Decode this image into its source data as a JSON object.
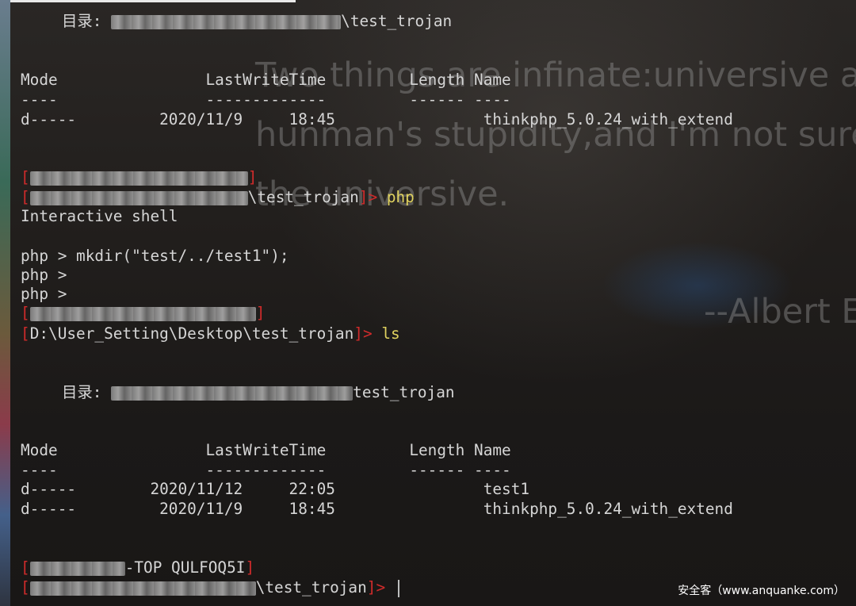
{
  "wallpaper": {
    "quote_line1": "Two things are infinate:universive ar",
    "quote_line2": "hunman's stupidity,and I'm not sure",
    "quote_line3": "the universive.",
    "quote_author": "--Albert E"
  },
  "terminal": {
    "dir1_label": "目录: ",
    "dir1_suffix": "\\test_trojan",
    "table1": {
      "header": "Mode                LastWriteTime         Length Name",
      "underline": "----                -------------         ------ ----",
      "rows": [
        "d-----         2020/11/9     18:45                thinkphp_5.0.24_with_extend"
      ]
    },
    "prompt1_bracket": "[",
    "prompt1_path_suffix": "\\test_trojan",
    "prompt1_end": "]> ",
    "prompt1_cmd": "php",
    "interactive": "Interactive shell",
    "php_line1": "php > mkdir(\"test/../test1\");",
    "php_line2": "php >",
    "php_line3": "php >",
    "prompt2_path": "D:\\User_Setting\\Desktop\\test_trojan",
    "prompt2_end": "]> ",
    "prompt2_cmd": "ls",
    "dir2_label": "目录: ",
    "dir2_suffix": "test_trojan",
    "table2": {
      "header": "Mode                LastWriteTime         Length Name",
      "underline": "----                -------------         ------ ----",
      "rows": [
        "d-----        2020/11/12     22:05                test1",
        "d-----         2020/11/9     18:45                thinkphp_5.0.24_with_extend"
      ]
    },
    "prompt3_partial": "-TOP QULFOQ5I",
    "prompt3_path_suffix": "\\test_trojan",
    "prompt3_end": "]> "
  },
  "watermark": "安全客（www.anquanke.com）"
}
